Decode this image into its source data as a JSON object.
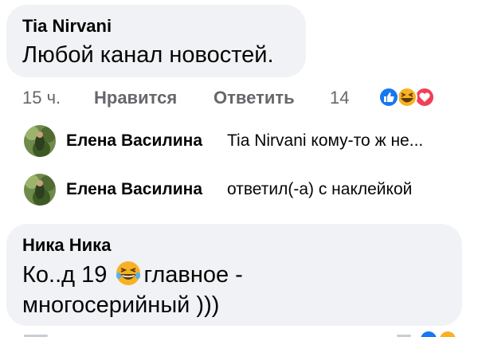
{
  "comments": [
    {
      "author": "Tia Nirvani",
      "text": "Любой канал новостей."
    },
    {
      "author": "Ника Ника",
      "text_line1_before": "Ко..д 19",
      "text_line1_after": "главное -",
      "text_line2": "многосерийный )))",
      "emoji_icon": "laughing-emoji-icon"
    }
  ],
  "actions": {
    "time": "15 ч.",
    "like_label": "Нравится",
    "reply_label": "Ответить",
    "reaction_count": "14",
    "reaction_icons": [
      "like-icon",
      "haha-icon",
      "love-icon"
    ]
  },
  "replies": [
    {
      "name": "Елена Василина",
      "text": "Tia Nirvani кому-то ж не..."
    },
    {
      "name": "Елена Василина",
      "text": "ответил(-а) с наклейкой"
    }
  ],
  "colors": {
    "bubble": "#f0f2f5",
    "meta_text": "#65676b",
    "like_blue": "#1877f2",
    "haha_yellow": "#f7b125",
    "love_red": "#f33e58"
  }
}
